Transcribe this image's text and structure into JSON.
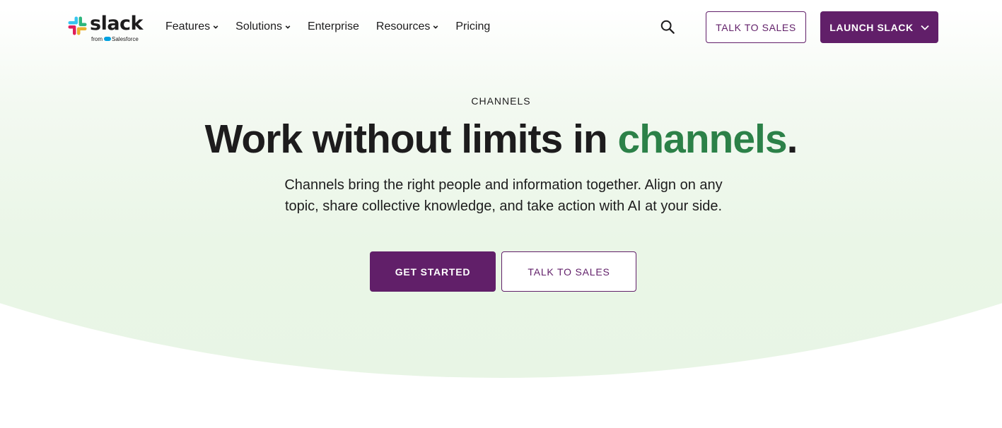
{
  "colors": {
    "brand_purple": "#611f69",
    "accent_green": "#2c8148",
    "text": "#1d1c1d",
    "hero_bg": "#e8f5e5"
  },
  "header": {
    "logo": {
      "wordmark": "slack",
      "tagline_prefix": "from",
      "tagline_brand": "Salesforce",
      "icon": "slack-hash-logo"
    },
    "nav": [
      {
        "label": "Features",
        "has_dropdown": true
      },
      {
        "label": "Solutions",
        "has_dropdown": true
      },
      {
        "label": "Enterprise",
        "has_dropdown": false
      },
      {
        "label": "Resources",
        "has_dropdown": true
      },
      {
        "label": "Pricing",
        "has_dropdown": false
      }
    ],
    "search_icon": "search-icon",
    "talk_to_sales_label": "TALK TO SALES",
    "launch_label": "LAUNCH SLACK"
  },
  "hero": {
    "eyebrow": "CHANNELS",
    "headline_main": "Work without limits in ",
    "headline_accent": "channels",
    "headline_end": ".",
    "subcopy": "Channels bring the right people and information together. Align on any topic, share collective knowledge, and take action with AI at your side.",
    "primary_cta": "GET STARTED",
    "secondary_cta": "TALK TO SALES"
  }
}
